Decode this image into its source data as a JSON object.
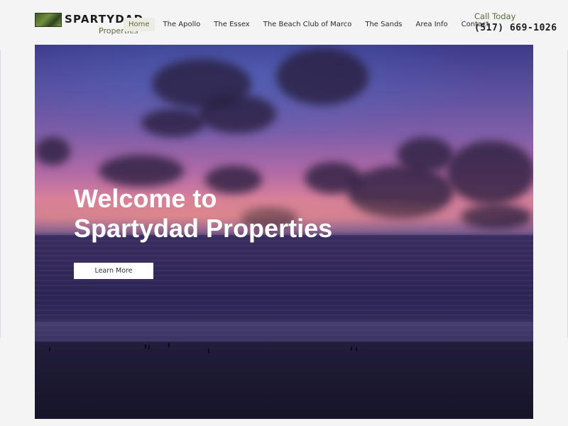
{
  "header": {
    "logo": {
      "name": "SPARTYDAD",
      "subtitle": "Properties"
    },
    "nav": [
      {
        "label": "Home",
        "active": true
      },
      {
        "label": "The Apollo",
        "active": false
      },
      {
        "label": "The Essex",
        "active": false
      },
      {
        "label": "The Beach Club of Marco",
        "active": false
      },
      {
        "label": "The Sands",
        "active": false
      },
      {
        "label": "Area Info",
        "active": false
      },
      {
        "label": "Contact",
        "active": false
      }
    ],
    "call": {
      "label": "Call Today",
      "phone": "(517) 669-1026"
    }
  },
  "hero": {
    "title_line1": "Welcome to",
    "title_line2": "Spartydad Properties",
    "button_label": "Learn More",
    "image_icon": "sunset-beach-photo"
  },
  "colors": {
    "accent": "#5b6a3d",
    "page_bg": "#f4f4f4",
    "button_bg": "#ffffff",
    "hero_text": "#ffffff"
  }
}
